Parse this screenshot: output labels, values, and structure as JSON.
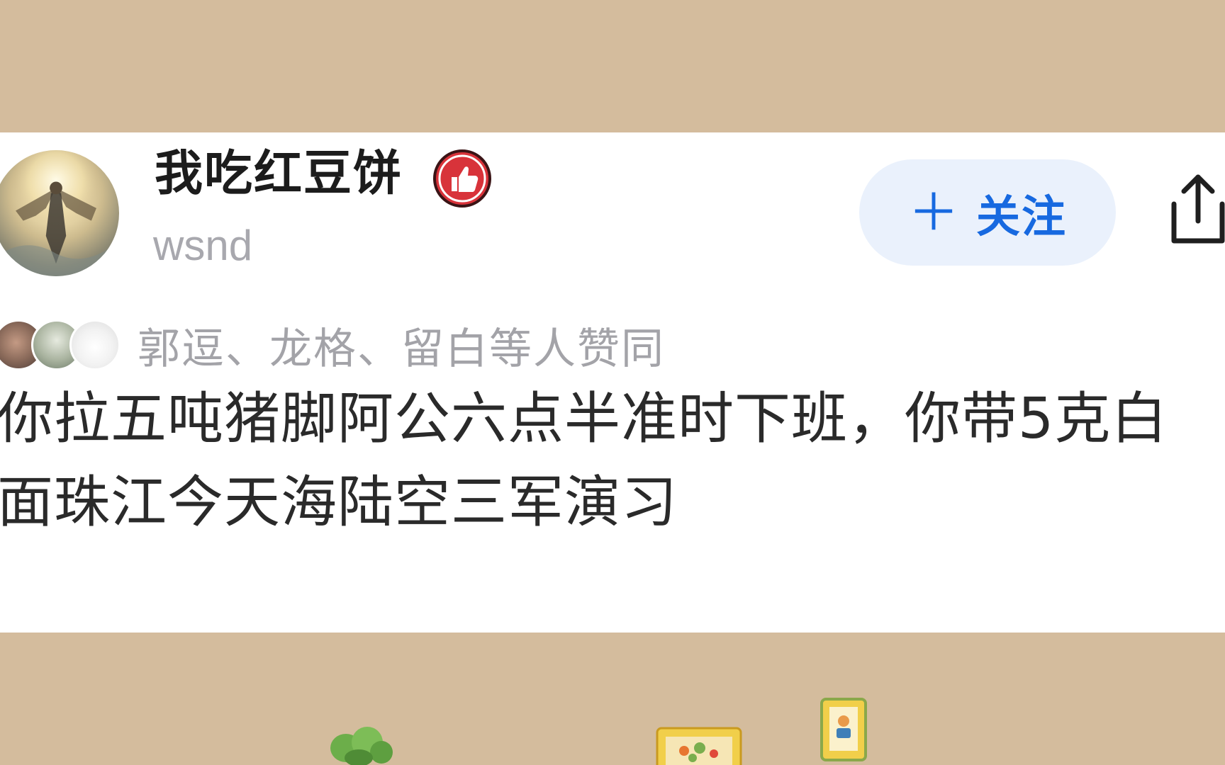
{
  "post": {
    "author_name": "我吃红豆饼",
    "author_handle": "wsnd",
    "follow_button_label": "关注",
    "follow_button_icon": "plus-icon",
    "badge_icon": "thumbs-up-badge-icon",
    "share_icon": "share-icon",
    "likers_text": "郭逗、龙格、留白等人赞同",
    "body_lines": [
      "你拉五吨猪脚阿公六点半准时下班，你带5克白",
      "面珠江今天海陆空三军演习"
    ]
  },
  "colors": {
    "background": "#d4bc9d",
    "card": "#ffffff",
    "accent_blue": "#1769e0",
    "follow_button_bg": "#eaf1fc",
    "badge_red": "#d8333a",
    "muted_gray": "#a3a3a8"
  }
}
